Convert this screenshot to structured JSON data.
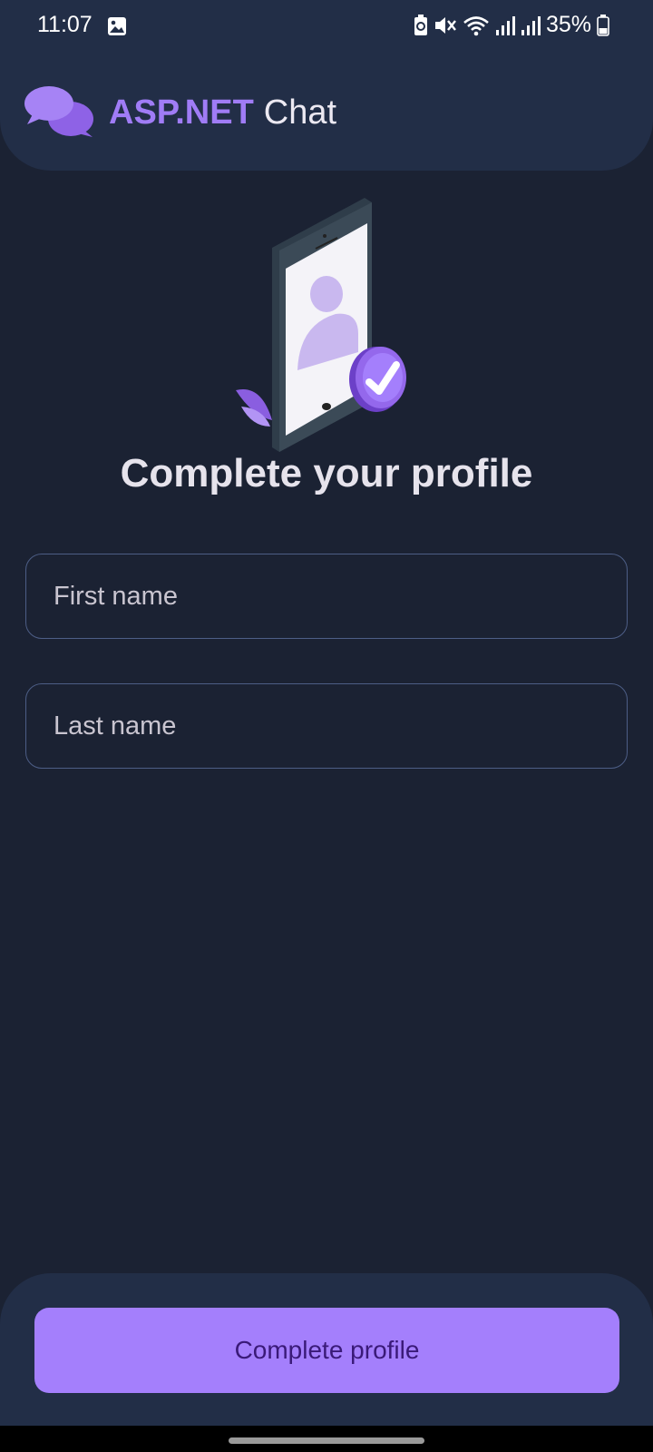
{
  "status_bar": {
    "time": "11:07",
    "battery": "35%",
    "icons": [
      "gallery-icon",
      "battery-saver-icon",
      "mute-icon",
      "wifi-icon",
      "signal-icon",
      "signal-icon",
      "battery-icon"
    ]
  },
  "header": {
    "brand_accent": "ASP.NET",
    "brand_rest": "Chat",
    "logo_icon": "chat-bubbles-icon"
  },
  "main": {
    "illustration_icon": "phone-profile-check-illustration",
    "title": "Complete your profile",
    "first_name": {
      "placeholder": "First name",
      "value": ""
    },
    "last_name": {
      "placeholder": "Last name",
      "value": ""
    }
  },
  "footer": {
    "complete_label": "Complete profile"
  },
  "colors": {
    "background": "#1b2233",
    "surface": "#222e47",
    "accent": "#a47ffc",
    "accent_text": "#3a1a78",
    "field_border": "#4d5e86"
  }
}
